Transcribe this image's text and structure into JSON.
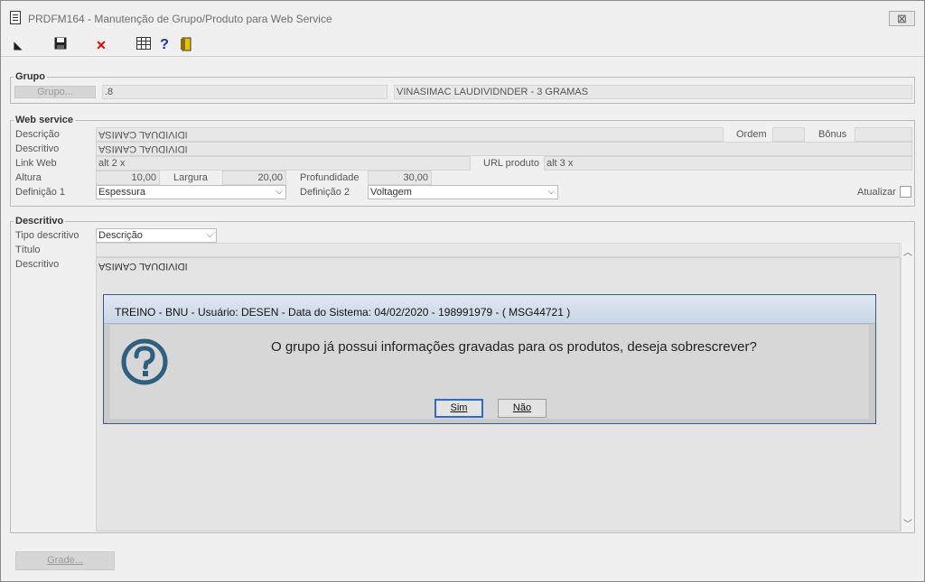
{
  "window": {
    "title": "PRDFM164 - Manutenção de Grupo/Produto para Web Service",
    "close_glyph": "⊠"
  },
  "toolbar": {
    "items": [
      {
        "name": "select",
        "icon": "cursor-arrow-icon",
        "glyph": "◣"
      },
      {
        "name": "save",
        "icon": "floppy-disk-icon",
        "glyph": "💾"
      },
      {
        "name": "delete",
        "icon": "red-x-icon",
        "glyph": "✕"
      },
      {
        "name": "grid",
        "icon": "table-grid-icon",
        "glyph": "▦"
      },
      {
        "name": "help",
        "icon": "question-mark-icon",
        "glyph": "?"
      },
      {
        "name": "exit",
        "icon": "exit-door-icon",
        "glyph": "⊐"
      }
    ]
  },
  "grupo": {
    "legend": "Grupo",
    "button_label": "Grupo...",
    "code": ".8",
    "description": "VINASIMAC LAUDIVIDNDER - 3 GRAMAS"
  },
  "webservice": {
    "legend": "Web service",
    "descricao_label": "Descrição",
    "descricao_value": "IDIVIDUAL CAMISA",
    "ordem_label": "Ordem",
    "bonus_label": "Bônus",
    "descritivo_label": "Descritivo",
    "descritivo_value": "IDIVIDUAL CAMISA",
    "linkweb_label": "Link Web",
    "linkweb_value": "alt 2 x",
    "urlproduto_label": "URL produto",
    "urlproduto_value": "alt 3 x",
    "altura_label": "Altura",
    "altura_value": "10,00",
    "largura_label": "Largura",
    "largura_value": "20,00",
    "profundidade_label": "Profundidade",
    "profundidade_value": "30,00",
    "definicao1_label": "Definição 1",
    "definicao1_value": "Espessura",
    "definicao2_label": "Definição 2",
    "definicao2_value": "Voltagem",
    "atualizar_label": "Atualizar"
  },
  "descritivo": {
    "legend": "Descritivo",
    "tipo_label": "Tipo descritivo",
    "tipo_value": "Descrição",
    "titulo_label": "Título",
    "descritivo_label": "Descritivo",
    "descritivo_value": "IDIVIDUAL CAMISA"
  },
  "footer": {
    "grade_label": "Grade..."
  },
  "dialog": {
    "title": "TREINO - BNU - Usuário: DESEN - Data do Sistema: 04/02/2020 - 198991979 - ( MSG44721 )",
    "message": "O grupo já possui informações gravadas para os produtos, deseja sobrescrever?",
    "yes_label": "Sim",
    "no_label": "Não",
    "accent": "#2f5f7f"
  }
}
